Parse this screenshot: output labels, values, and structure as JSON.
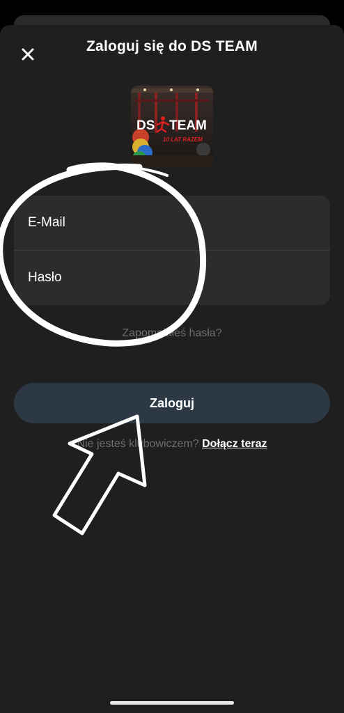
{
  "header": {
    "title": "Zaloguj się do DS TEAM",
    "close_icon": "close-icon"
  },
  "logo": {
    "brand_left": "DS",
    "brand_right": "TEAM",
    "tagline": "10 LAT RAZEM"
  },
  "form": {
    "email_label": "E-Mail",
    "password_label": "Hasło"
  },
  "forgot_password": "Zapomniałeś hasła?",
  "login_button": "Zaloguj",
  "join": {
    "prompt": "Nie jesteś klubowiczem?",
    "link": "Dołącz teraz"
  },
  "colors": {
    "sheet_bg": "#1f1f1f",
    "field_bg": "#2c2c2c",
    "button_bg": "#2c3944",
    "muted_text": "#6e6e6e"
  }
}
